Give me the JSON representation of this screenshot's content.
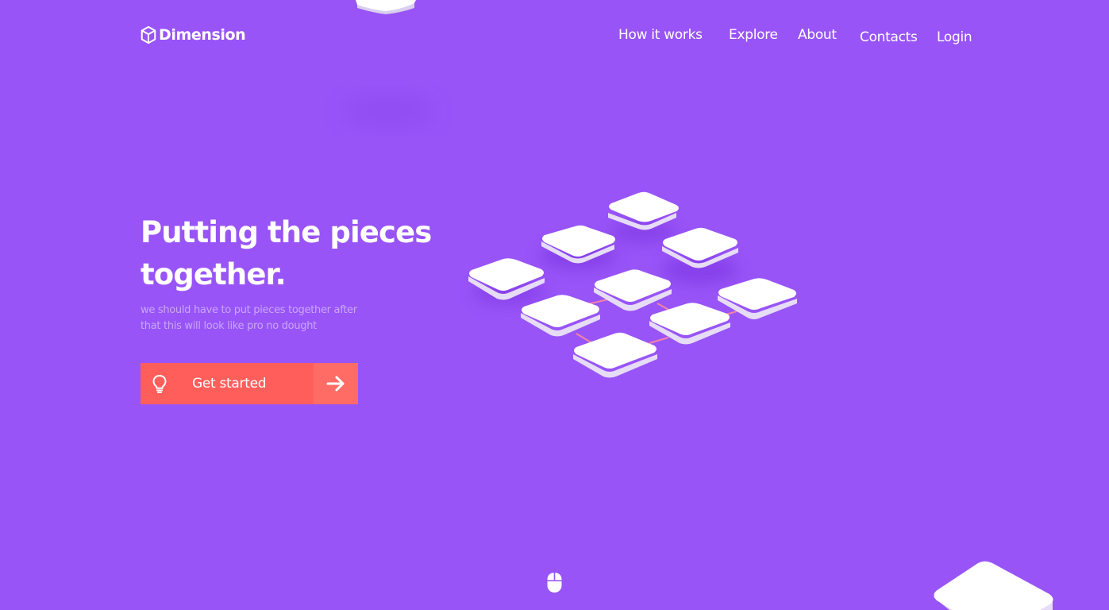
{
  "brand": {
    "name": "Dimension",
    "icon": "cube-icon"
  },
  "nav": {
    "items": [
      {
        "label": "How it works"
      },
      {
        "label": "Explore"
      },
      {
        "label": "About"
      },
      {
        "label": "Contacts"
      },
      {
        "label": "Login"
      }
    ]
  },
  "hero": {
    "title_line1": "Putting the pieces",
    "title_line2": "together.",
    "subtitle_line1": "we should have to put pieces together after",
    "subtitle_line2": "that this will look like pro no dought",
    "cta": {
      "label": "Get started",
      "icon": "lightbulb-icon",
      "arrow_icon": "arrow-right-icon"
    }
  },
  "scroll_indicator": {
    "icon": "mouse-icon"
  },
  "colors": {
    "background": "#9854f7",
    "cta": "#ff5e5b",
    "cta_arrow_bg": "#ff6c66",
    "subtitle": "#c9a6fb",
    "tile": "#ffffff",
    "connector": "#ff8a9a"
  }
}
